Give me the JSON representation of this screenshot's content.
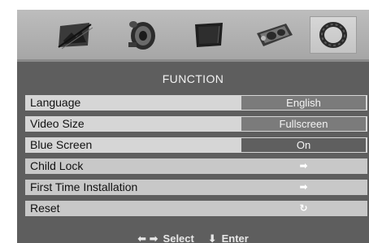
{
  "tabs": [
    {
      "icon": "picture-icon"
    },
    {
      "icon": "speaker-icon"
    },
    {
      "icon": "tv-screen-icon"
    },
    {
      "icon": "clock-icon"
    },
    {
      "icon": "function-ring-icon",
      "selected": true
    }
  ],
  "menu": {
    "title": "FUNCTION",
    "rows": [
      {
        "label": "Language",
        "value": "English"
      },
      {
        "label": "Video Size",
        "value": "Fullscreen"
      },
      {
        "label": "Blue Screen",
        "value": "On"
      },
      {
        "label": "Child Lock",
        "value_icon": "right-arrow-icon",
        "glyph": "➡"
      },
      {
        "label": "First Time Installation",
        "value_icon": "right-arrow-icon",
        "glyph": "➡"
      },
      {
        "label": "Reset",
        "value_icon": "reset-icon",
        "glyph": "↻"
      }
    ]
  },
  "hint": {
    "select_arrows": "⬅ ➡",
    "select_label": "Select",
    "enter_arrow": "⬇",
    "enter_label": "Enter"
  },
  "colors": {
    "osd_background": "#5e5e5e",
    "row_background": "#d6d6d6",
    "value_background": "#7b7b7b"
  }
}
